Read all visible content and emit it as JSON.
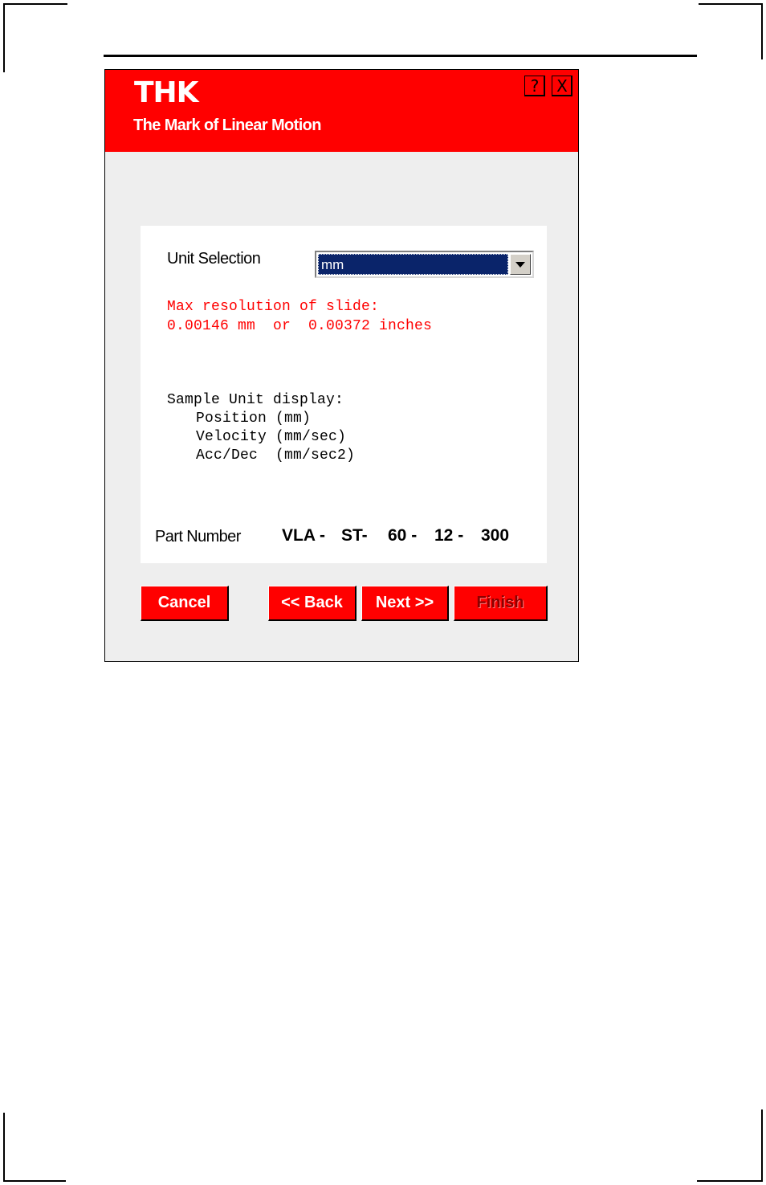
{
  "brand": {
    "logo": "THK",
    "tagline": "The Mark of Linear Motion"
  },
  "window_controls": {
    "help": "?",
    "close": "X"
  },
  "unit_selection": {
    "label": "Unit Selection",
    "selected": "mm"
  },
  "resolution": {
    "line1": "Max resolution of slide:",
    "line2": "0.00146 mm  or  0.00372 inches"
  },
  "sample_display": {
    "title": "Sample Unit display:",
    "position": "Position (mm)",
    "velocity": "Velocity (mm/sec)",
    "accdec": "Acc/Dec  (mm/sec2)"
  },
  "part_number": {
    "label": "Part Number",
    "segments": [
      "VLA -",
      "ST-",
      "60 -",
      "12 -",
      "300"
    ]
  },
  "buttons": {
    "cancel": "Cancel",
    "back": "<< Back",
    "next": "Next >>",
    "finish": "Finish"
  },
  "colors": {
    "accent": "#ff0000",
    "selection": "#0a246a",
    "panel_bg": "#eeeeee"
  }
}
